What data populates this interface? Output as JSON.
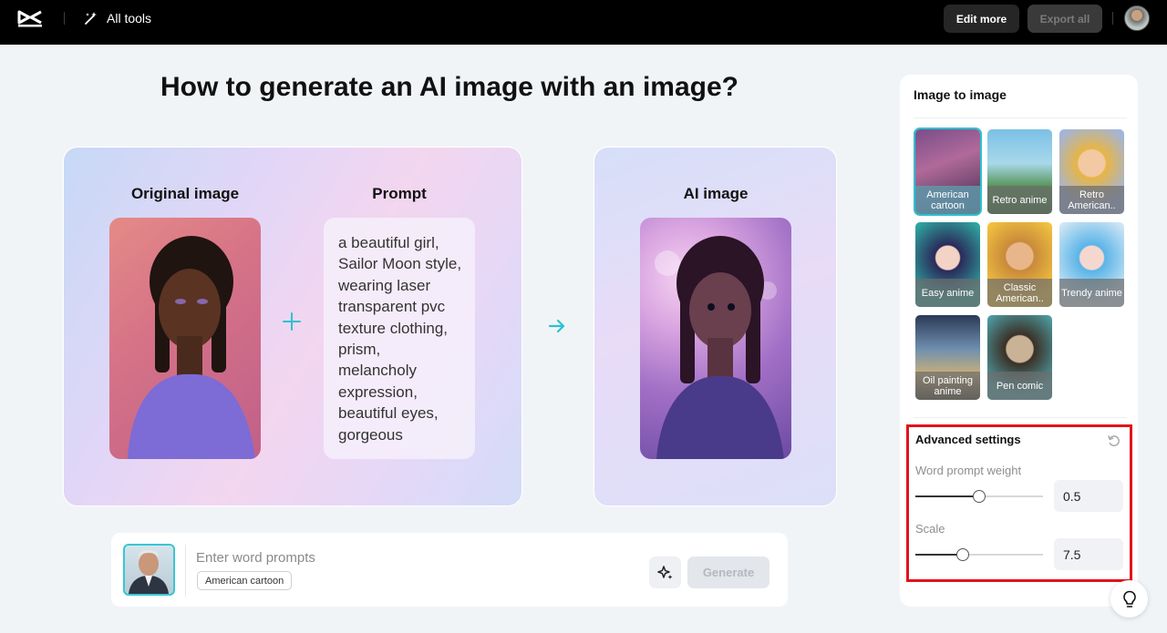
{
  "topbar": {
    "all_tools_label": "All tools",
    "edit_more_label": "Edit more",
    "export_all_label": "Export all"
  },
  "main": {
    "title": "How to generate an AI image with an image?",
    "original_label": "Original image",
    "prompt_label": "Prompt",
    "prompt_text": "a beautiful girl, Sailor Moon style, wearing laser transparent pvc texture clothing, prism, melancholy expression, beautiful eyes, gorgeous",
    "ai_label": "AI image"
  },
  "input_bar": {
    "placeholder": "Enter word prompts",
    "style_chip": "American cartoon",
    "generate_label": "Generate"
  },
  "panel": {
    "title": "Image to image",
    "styles": [
      {
        "label": "American cartoon",
        "selected": true
      },
      {
        "label": "Retro anime",
        "selected": false
      },
      {
        "label": "Retro American..",
        "selected": false
      },
      {
        "label": "Easy anime",
        "selected": false
      },
      {
        "label": "Classic American..",
        "selected": false
      },
      {
        "label": "Trendy anime",
        "selected": false
      },
      {
        "label": "Oil painting anime",
        "selected": false
      },
      {
        "label": "Pen comic",
        "selected": false
      }
    ],
    "advanced": {
      "title": "Advanced settings",
      "word_weight_label": "Word prompt weight",
      "word_weight_value": "0.5",
      "scale_label": "Scale",
      "scale_value": "7.5"
    }
  },
  "colors": {
    "accent": "#2cc2d0",
    "highlight_frame": "#e0141c"
  },
  "icons": [
    "capcut-logo-icon",
    "magic-wand-icon",
    "plus-icon",
    "arrow-right-icon",
    "sparkle-icon",
    "reset-icon",
    "lightbulb-icon"
  ]
}
